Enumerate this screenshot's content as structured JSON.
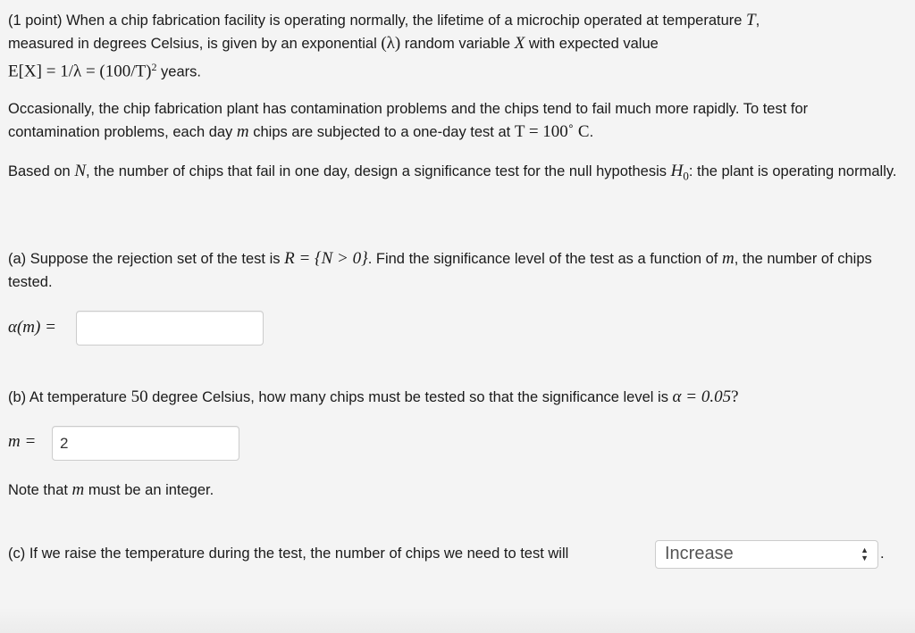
{
  "intro": {
    "s1": "(1 point)   When a chip fabrication facility is operating normally, the lifetime of a microchip operated at temperature ",
    "T": "T",
    "s2": ",",
    "s3": "measured in degrees Celsius, is given by an exponential ",
    "lambda": "(λ)",
    "s4": " random variable ",
    "X": "X",
    "s5": " with expected value",
    "formula": "E[X] = 1/λ = (100/T)",
    "sup": "2",
    "s6": " years."
  },
  "para2": {
    "s1": "Occasionally, the chip fabrication plant has contamination problems and the chips tend to fail much more rapidly. To test for contamination problems, each day ",
    "m": "m",
    "s2": " chips are subjected to a one-day test at ",
    "eq": "T = 100˚ C",
    "s3": "."
  },
  "para3": {
    "s1": "Based on ",
    "N": "N",
    "s2": ", the number of chips that fail in one day, design a significance test for the null hypothesis ",
    "H0": "H",
    "H0sub": "0",
    "s3": ":   the plant is operating normally."
  },
  "part_a": {
    "s1": "(a)  Suppose the rejection set of the test is ",
    "R": "R = {N > 0}",
    "s2": ". Find the significance level of the test as a function of ",
    "m": "m",
    "s3": ", the number of chips tested.",
    "label": "α(m) =",
    "value": ""
  },
  "part_b": {
    "s1": "(b)  At temperature ",
    "temp": "50",
    "s2": " degree Celsius, how many chips must be tested so that the significance level is ",
    "alpha": "α = 0.05",
    "s3": "?",
    "label": "m =",
    "value": "2",
    "note1": "Note that ",
    "note_m": "m",
    "note2": " must be an integer."
  },
  "part_c": {
    "s1": "(c)  If we raise the temperature during the test, the number of chips we need to test will",
    "selected": "Increase",
    "s2": "."
  }
}
